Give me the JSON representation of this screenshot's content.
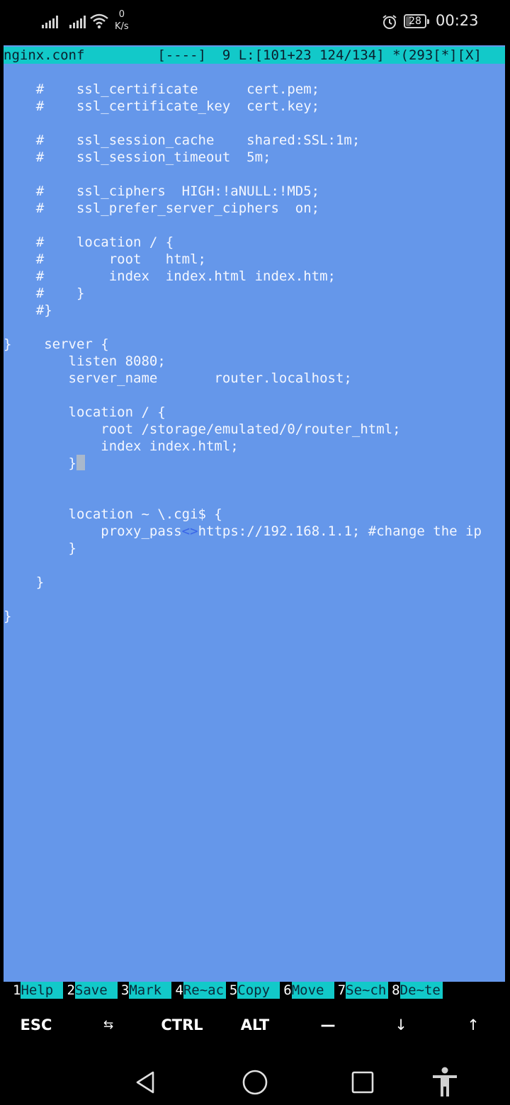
{
  "status_bar": {
    "net_speed_value": "0",
    "net_speed_unit": "K/s",
    "battery_level": "28",
    "battery_fraction": 0.28,
    "time": "00:23",
    "icons": [
      "cell-signal-1",
      "cell-signal-2",
      "wifi",
      "alarm",
      "battery"
    ]
  },
  "editor": {
    "title_bar": "nginx.conf         [----]  9 L:[101+23 124/134] *(293[*][X]",
    "lines": [
      "    #    ssl_certificate      cert.pem;",
      "    #    ssl_certificate_key  cert.key;",
      "",
      "    #    ssl_session_cache    shared:SSL:1m;",
      "    #    ssl_session_timeout  5m;",
      "",
      "    #    ssl_ciphers  HIGH:!aNULL:!MD5;",
      "    #    ssl_prefer_server_ciphers  on;",
      "",
      "    #    location / {",
      "    #        root   html;",
      "    #        index  index.html index.htm;",
      "    #    }",
      "    #}",
      "",
      "}    server {",
      "        listen 8080;",
      "        server_name       router.localhost;",
      "",
      "        location / {",
      "            root /storage/emulated/0/router_html;",
      "            index index.html;",
      "        }",
      "",
      "",
      "        location ~ \\.cgi$ {",
      "            proxy_pass",
      "        }",
      "",
      "    }",
      "",
      "}"
    ],
    "proxy_tab_marker": "<>",
    "proxy_rest": "https://192.168.1.1; #change the ip"
  },
  "function_keys": [
    {
      "num": "1",
      "label": "Help"
    },
    {
      "num": "2",
      "label": "Save"
    },
    {
      "num": "3",
      "label": "Mark"
    },
    {
      "num": "4",
      "label": "Re~ac"
    },
    {
      "num": "5",
      "label": "Copy"
    },
    {
      "num": "6",
      "label": "Move"
    },
    {
      "num": "7",
      "label": "Se~ch"
    },
    {
      "num": "8",
      "label": "De~te"
    }
  ],
  "extra_keys": {
    "esc": "ESC",
    "tab": "⇆",
    "ctrl": "CTRL",
    "alt": "ALT",
    "dash": "—",
    "down": "↓",
    "up": "↑"
  },
  "nav_bar": {
    "icons": [
      "back-triangle",
      "home-circle",
      "recents-square",
      "accessibility-figure"
    ]
  }
}
